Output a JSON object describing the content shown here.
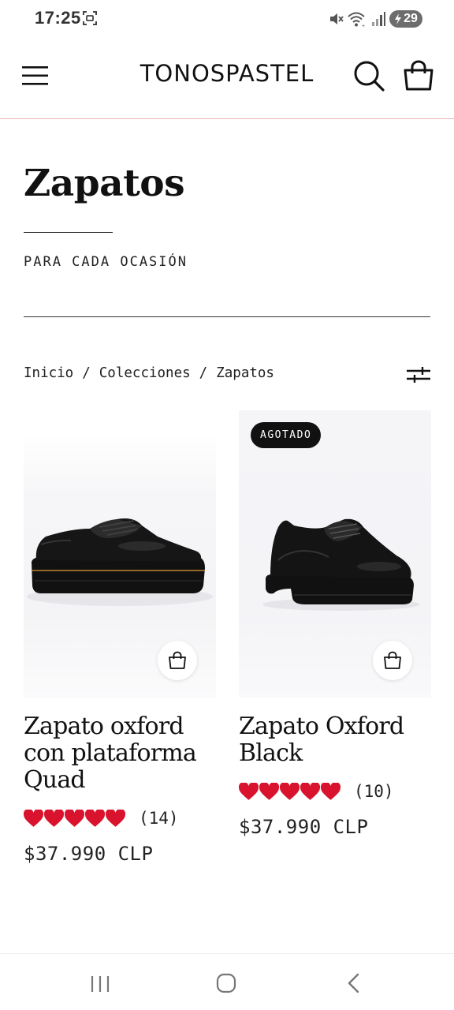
{
  "status_bar": {
    "time": "17:25",
    "battery_level": "29",
    "icons": [
      "screenshot-icon",
      "mute-icon",
      "wifi-icon",
      "signal-icon",
      "battery-charging-icon"
    ]
  },
  "header": {
    "brand": "TONOSPASTEL",
    "icons": [
      "menu-icon",
      "search-icon",
      "cart-icon"
    ],
    "divider_color": "#e9b4b8"
  },
  "collection": {
    "title": "Zapatos",
    "subtitle": "PARA CADA OCASIÓN"
  },
  "breadcrumb": {
    "items": [
      "Inicio",
      "Colecciones",
      "Zapatos"
    ],
    "separator": "/"
  },
  "products": [
    {
      "name": "Zapato oxford con plataforma Quad",
      "rating_stars": 5,
      "review_count": "(14)",
      "price": "$37.990 CLP",
      "badge": ""
    },
    {
      "name": "Zapato Oxford Black",
      "rating_stars": 5,
      "review_count": "(10)",
      "price": "$37.990 CLP",
      "badge": "AGOTADO"
    }
  ],
  "colors": {
    "heart": "#d9132e",
    "text": "#111111",
    "badge_bg": "#111111"
  },
  "nav_bar": {
    "icons": [
      "recent-apps-icon",
      "home-icon",
      "back-icon"
    ]
  }
}
